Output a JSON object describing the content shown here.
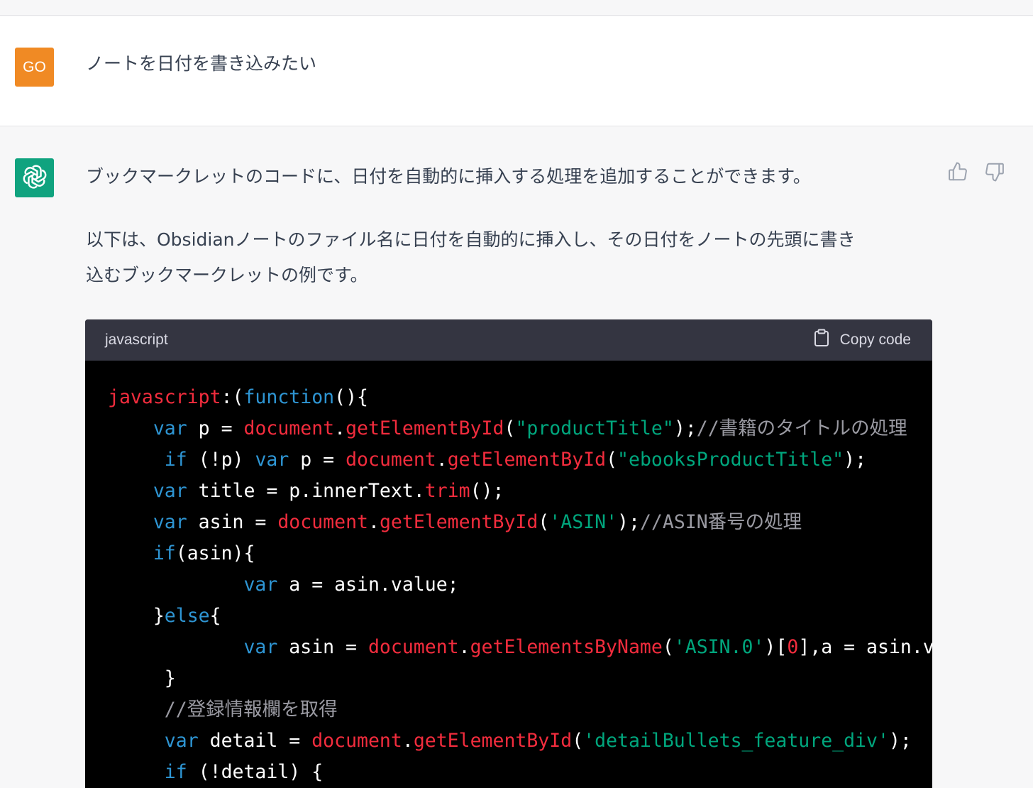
{
  "user": {
    "avatar_text": "GO",
    "message": "ノートを日付を書き込みたい"
  },
  "assistant": {
    "paragraph1": "ブックマークレットのコードに、日付を自動的に挿入する処理を追加することができます。",
    "paragraph2_line1": "以下は、Obsidianノートのファイル名に日付を自動的に挿入し、その日付をノートの先頭に書き",
    "paragraph2_line2": "込むブックマークレットの例です。"
  },
  "code": {
    "language": "javascript",
    "copy_label": "Copy code",
    "lines": [
      [
        [
          "r",
          "javascript"
        ],
        [
          "w",
          ":("
        ],
        [
          "k",
          "function"
        ],
        [
          "w",
          "(){"
        ]
      ],
      [
        [
          "w",
          "    "
        ],
        [
          "k",
          "var"
        ],
        [
          "w",
          " p = "
        ],
        [
          "r",
          "document"
        ],
        [
          "w",
          "."
        ],
        [
          "r",
          "getElementById"
        ],
        [
          "w",
          "("
        ],
        [
          "g",
          "\"productTitle\""
        ],
        [
          "w",
          ");"
        ],
        [
          "c",
          "//書籍のタイトルの処理"
        ]
      ],
      [
        [
          "w",
          "     "
        ],
        [
          "k",
          "if"
        ],
        [
          "w",
          " (!p) "
        ],
        [
          "k",
          "var"
        ],
        [
          "w",
          " p = "
        ],
        [
          "r",
          "document"
        ],
        [
          "w",
          "."
        ],
        [
          "r",
          "getElementById"
        ],
        [
          "w",
          "("
        ],
        [
          "g",
          "\"ebooksProductTitle\""
        ],
        [
          "w",
          ");"
        ]
      ],
      [
        [
          "w",
          "    "
        ],
        [
          "k",
          "var"
        ],
        [
          "w",
          " title = p.innerText."
        ],
        [
          "r",
          "trim"
        ],
        [
          "w",
          "();"
        ]
      ],
      [
        [
          "w",
          "    "
        ],
        [
          "k",
          "var"
        ],
        [
          "w",
          " asin = "
        ],
        [
          "r",
          "document"
        ],
        [
          "w",
          "."
        ],
        [
          "r",
          "getElementById"
        ],
        [
          "w",
          "("
        ],
        [
          "g",
          "'ASIN'"
        ],
        [
          "w",
          ");"
        ],
        [
          "c",
          "//ASIN番号の処理"
        ]
      ],
      [
        [
          "w",
          "    "
        ],
        [
          "k",
          "if"
        ],
        [
          "w",
          "(asin){"
        ]
      ],
      [
        [
          "w",
          "            "
        ],
        [
          "k",
          "var"
        ],
        [
          "w",
          " a = asin.value;"
        ]
      ],
      [
        [
          "w",
          "    }"
        ],
        [
          "k",
          "else"
        ],
        [
          "w",
          "{"
        ]
      ],
      [
        [
          "w",
          "            "
        ],
        [
          "k",
          "var"
        ],
        [
          "w",
          " asin = "
        ],
        [
          "r",
          "document"
        ],
        [
          "w",
          "."
        ],
        [
          "r",
          "getElementsByName"
        ],
        [
          "w",
          "("
        ],
        [
          "g",
          "'ASIN.0'"
        ],
        [
          "w",
          ")["
        ],
        [
          "r",
          "0"
        ],
        [
          "w",
          "],a = asin.valu"
        ]
      ],
      [
        [
          "w",
          "     }"
        ]
      ],
      [
        [
          "c",
          "     //登録情報欄を取得"
        ]
      ],
      [
        [
          "w",
          "     "
        ],
        [
          "k",
          "var"
        ],
        [
          "w",
          " detail = "
        ],
        [
          "r",
          "document"
        ],
        [
          "w",
          "."
        ],
        [
          "r",
          "getElementById"
        ],
        [
          "w",
          "("
        ],
        [
          "g",
          "'detailBullets_feature_div'"
        ],
        [
          "w",
          ");"
        ]
      ],
      [
        [
          "w",
          "     "
        ],
        [
          "k",
          "if"
        ],
        [
          "w",
          " (!detail) {"
        ]
      ]
    ]
  },
  "icons": {
    "bot_avatar": "openai-logo-icon",
    "copy": "clipboard-icon",
    "like": "thumbs-up-icon",
    "dislike": "thumbs-down-icon"
  },
  "colors": {
    "user_avatar_bg": "#f08a24",
    "bot_avatar_bg": "#10a37f",
    "code_bg": "#000000",
    "code_header_bg": "#343541"
  }
}
